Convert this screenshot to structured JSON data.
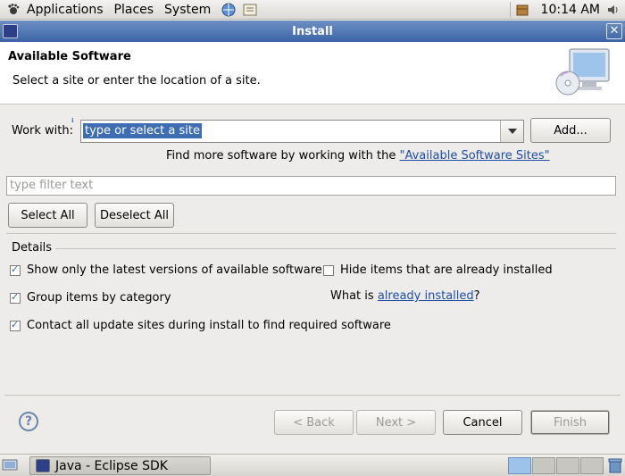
{
  "top_panel": {
    "menus": [
      "Applications",
      "Places",
      "System"
    ],
    "clock": "10:14 AM"
  },
  "window": {
    "title": "Install"
  },
  "banner": {
    "title": "Available Software",
    "description": "Select a site or enter the location of a site."
  },
  "work_with": {
    "label": "Work with:",
    "value": "type or select a site",
    "add_button": "Add..."
  },
  "find_more": {
    "text": "Find more software by working with the ",
    "link": "\"Available Software Sites\""
  },
  "filter": {
    "placeholder": "type filter text"
  },
  "selection_buttons": {
    "select_all": "Select All",
    "deselect_all": "Deselect All"
  },
  "details": {
    "label": "Details",
    "show_latest": {
      "label": "Show only the latest versions of available software",
      "checked": true
    },
    "hide_installed": {
      "label": "Hide items that are already installed",
      "checked": false
    },
    "group_by_category": {
      "label": "Group items by category",
      "checked": true
    },
    "what_is_prefix": "What is ",
    "already_installed_link": "already installed",
    "what_is_suffix": "?",
    "contact_sites": {
      "label": "Contact all update sites during install to find required software",
      "checked": true
    }
  },
  "footer_buttons": {
    "back": "< Back",
    "next": "Next >",
    "cancel": "Cancel",
    "finish": "Finish"
  },
  "taskbar": {
    "task": "Java - Eclipse SDK"
  },
  "colors": {
    "titlebar": "#3c64a6",
    "selection": "#3e6db3",
    "link": "#1f4ea4"
  }
}
